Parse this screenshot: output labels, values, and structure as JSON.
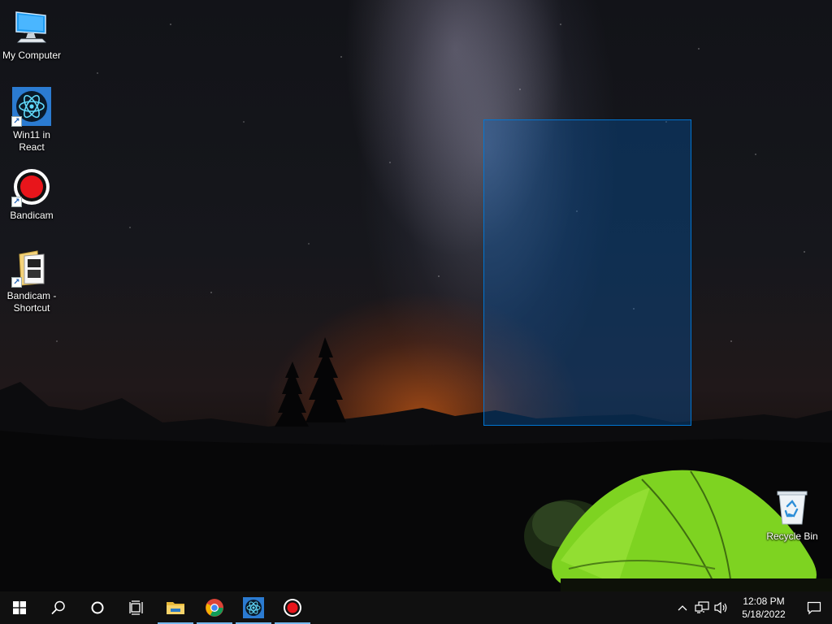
{
  "desktop": {
    "icons": [
      {
        "label": "My Computer",
        "icon": "computer-icon"
      },
      {
        "label": "Win11 in React",
        "icon": "react-atom-icon"
      },
      {
        "label": "Bandicam",
        "icon": "bandicam-record-icon"
      },
      {
        "label": "Bandicam - Shortcut",
        "icon": "folder-file-icon"
      },
      {
        "label": "Recycle Bin",
        "icon": "recycle-bin-icon"
      }
    ]
  },
  "taskbar": {
    "items": [
      {
        "name": "start",
        "icon": "windows-logo-icon"
      },
      {
        "name": "search",
        "icon": "search-icon"
      },
      {
        "name": "cortana",
        "icon": "cortana-circle-icon"
      },
      {
        "name": "task-view",
        "icon": "task-view-icon"
      },
      {
        "name": "file-explorer",
        "icon": "folder-icon",
        "active": true
      },
      {
        "name": "chrome",
        "icon": "chrome-icon",
        "active": true
      },
      {
        "name": "win11-react",
        "icon": "react-atom-icon",
        "active": true
      },
      {
        "name": "bandicam",
        "icon": "bandicam-record-icon",
        "active": true
      }
    ],
    "tray": {
      "icons": [
        "chevron-up-icon",
        "network-icon",
        "volume-icon"
      ],
      "time": "12:08 PM",
      "date": "5/18/2022",
      "notification_icon": "action-center-icon"
    }
  },
  "colors": {
    "taskbar_bg": "#101010",
    "selection_fill": "#0066cc",
    "selection_border": "#0078d7",
    "active_indicator": "#76b9ed",
    "bandicam_red": "#e8151b",
    "tent_green": "#7ed321"
  }
}
